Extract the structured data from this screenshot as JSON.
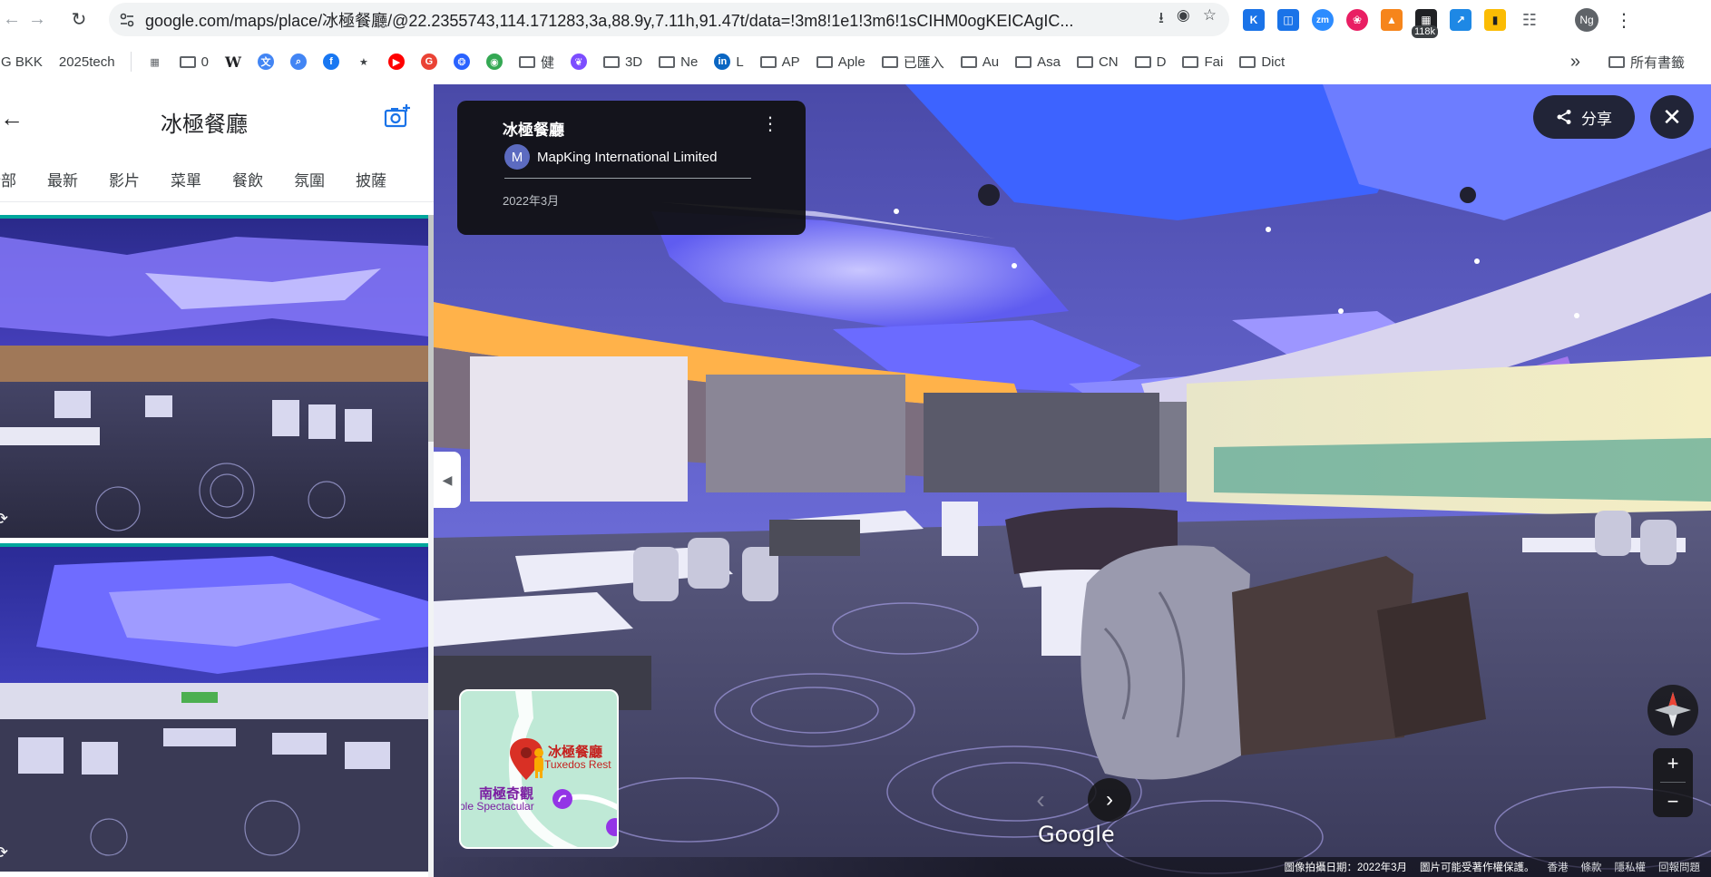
{
  "browser": {
    "url": "google.com/maps/place/冰極餐廳/@22.2355743,114.171283,3a,88.9y,7.11h,91.47t/data=!3m8!1e1!3m6!1sCIHM0ogKEICAgIC...",
    "extension_badge": "118k",
    "profile_initials": "Ng",
    "extensions": [
      {
        "name": "k-extension-icon",
        "label": "K",
        "color": "#1a73e8"
      },
      {
        "name": "shield-extension-icon",
        "label": "",
        "color": "#1a73e8"
      },
      {
        "name": "zoom-extension-icon",
        "label": "zm",
        "color": "#2d8cff"
      },
      {
        "name": "brain-extension-icon",
        "label": "",
        "color": "#e91e63"
      },
      {
        "name": "metamask-extension-icon",
        "label": "",
        "color": "#f6851b"
      },
      {
        "name": "ruler-extension-icon",
        "label": "",
        "color": "#202124"
      },
      {
        "name": "graph-extension-icon",
        "label": "",
        "color": "#1e88e5"
      },
      {
        "name": "bars-extension-icon",
        "label": "",
        "color": "#fbbc04"
      },
      {
        "name": "puzzle-extension-icon",
        "label": "",
        "color": "#5f6368"
      }
    ]
  },
  "bookmarks": {
    "items": [
      {
        "type": "text",
        "label": "G BKK"
      },
      {
        "type": "text",
        "label": "2025tech"
      },
      {
        "type": "icon",
        "label": "",
        "icon": "grid-icon",
        "color": "#5f6368"
      },
      {
        "type": "folder",
        "label": "0"
      },
      {
        "type": "icon",
        "label": "W",
        "icon": "wikipedia-icon",
        "color": "#202124"
      },
      {
        "type": "icon",
        "label": "",
        "icon": "translate-icon",
        "color": "#4285f4"
      },
      {
        "type": "icon",
        "label": "",
        "icon": "search-icon",
        "color": "#4285f4"
      },
      {
        "type": "icon",
        "label": "",
        "icon": "facebook-icon",
        "color": "#1877f2"
      },
      {
        "type": "icon",
        "label": "",
        "icon": "star-icon",
        "color": "#3c4043"
      },
      {
        "type": "icon",
        "label": "",
        "icon": "youtube-icon",
        "color": "#ff0000"
      },
      {
        "type": "icon",
        "label": "",
        "icon": "google-icon",
        "color": "#ea4335"
      },
      {
        "type": "icon",
        "label": "",
        "icon": "paw-icon",
        "color": "#2962ff"
      },
      {
        "type": "icon",
        "label": "",
        "icon": "maps-icon",
        "color": "#34a853"
      },
      {
        "type": "folder",
        "label": "健"
      },
      {
        "type": "icon",
        "label": "",
        "icon": "butterfly-icon",
        "color": "#7c4dff"
      },
      {
        "type": "folder",
        "label": "3D"
      },
      {
        "type": "folder",
        "label": "Ne"
      },
      {
        "type": "icon",
        "label": "L",
        "icon": "linkedin-icon",
        "color": "#0a66c2"
      },
      {
        "type": "folder",
        "label": "AP"
      },
      {
        "type": "folder",
        "label": "Aple"
      },
      {
        "type": "folder",
        "label": "已匯入"
      },
      {
        "type": "folder",
        "label": "Au"
      },
      {
        "type": "folder",
        "label": "Asa"
      },
      {
        "type": "folder",
        "label": "CN"
      },
      {
        "type": "folder",
        "label": "D"
      },
      {
        "type": "folder",
        "label": "Fai"
      },
      {
        "type": "folder",
        "label": "Dict"
      }
    ],
    "overflow": "»",
    "all_bookmarks": "所有書籤"
  },
  "photos_panel": {
    "title": "冰極餐廳",
    "tabs": [
      "全部",
      "最新",
      "影片",
      "菜單",
      "餐飲",
      "氛圍",
      "披薩"
    ]
  },
  "streetview": {
    "card": {
      "place": "冰極餐廳",
      "author_initial": "M",
      "author": "MapKing International Limited",
      "date": "2022年3月"
    },
    "share_label": "分享",
    "minimap": {
      "place_cn": "冰極餐廳",
      "place_en": "Tuxedos Rest",
      "poi_cn": "南極奇觀",
      "poi_en": "ple Spectacular"
    },
    "google": "Google",
    "footer": {
      "capture": "圖像拍攝日期：2022年3月",
      "copyright": "圖片可能受著作權保護。",
      "region": "香港",
      "terms": "條款",
      "privacy": "隱私權",
      "report": "回報問題"
    }
  }
}
